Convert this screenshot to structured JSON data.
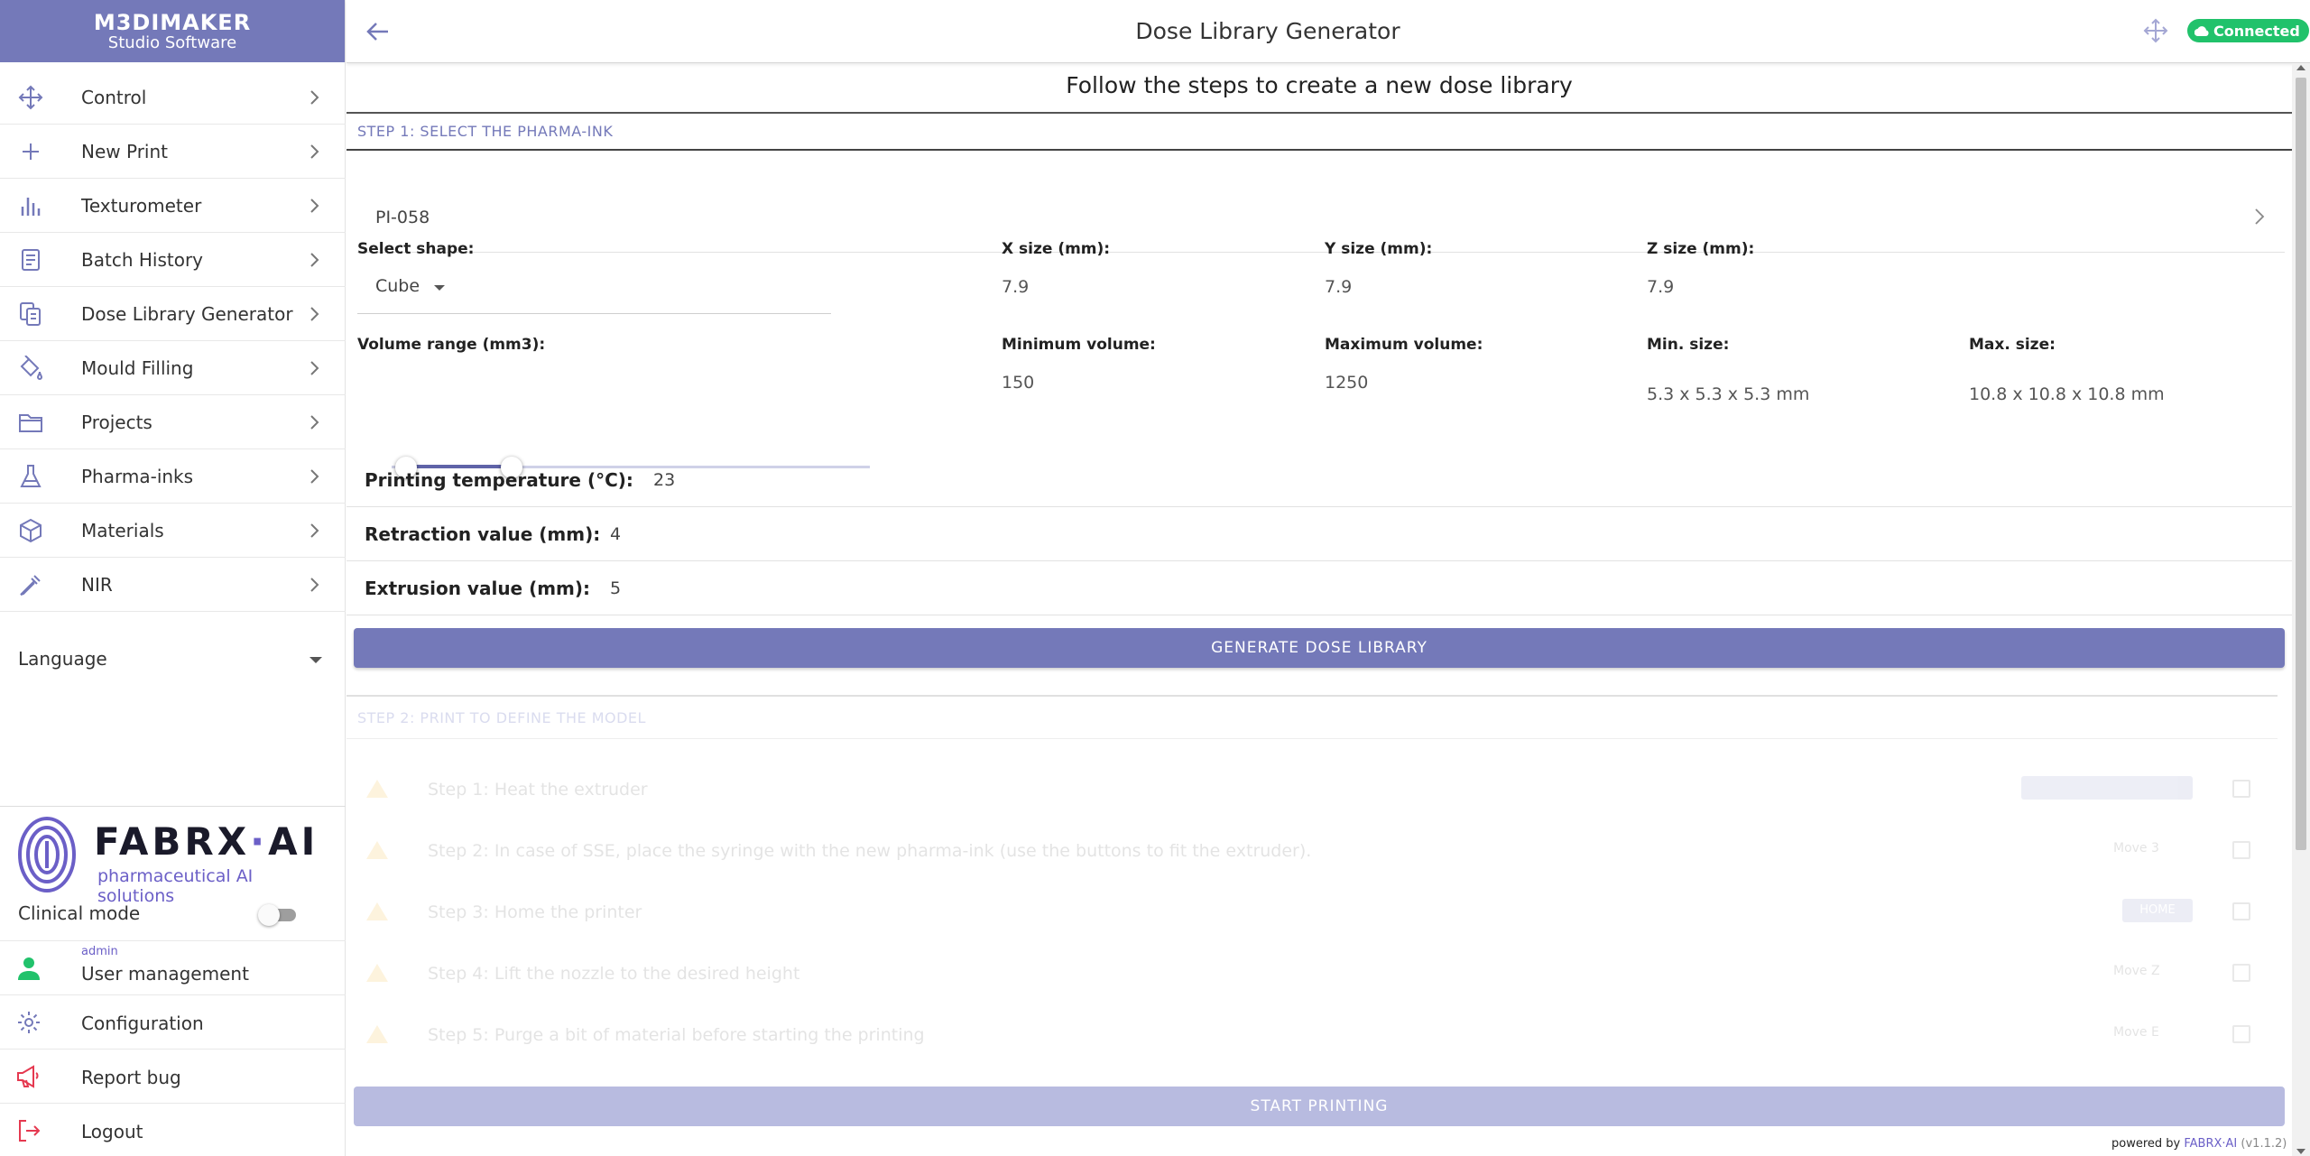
{
  "app": {
    "name_line1": "M3DIMAKER",
    "name_line2": "Studio Software"
  },
  "nav": [
    {
      "label": "Control",
      "icon": "move-arrows-icon"
    },
    {
      "label": "New Print",
      "icon": "plus-icon"
    },
    {
      "label": "Texturometer",
      "icon": "bar-chart-icon"
    },
    {
      "label": "Batch History",
      "icon": "document-icon"
    },
    {
      "label": "Dose Library Generator",
      "icon": "copy-document-icon"
    },
    {
      "label": "Mould Filling",
      "icon": "paint-bucket-icon"
    },
    {
      "label": "Projects",
      "icon": "folder-icon"
    },
    {
      "label": "Pharma-inks",
      "icon": "flask-icon"
    },
    {
      "label": "Materials",
      "icon": "cube-icon"
    },
    {
      "label": "NIR",
      "icon": "pipette-icon"
    }
  ],
  "language": {
    "label": "Language"
  },
  "brand": {
    "word_a": "FABRX",
    "dot": "·",
    "word_b": "AI",
    "tagline": "pharmaceutical AI solutions"
  },
  "clinical_mode": {
    "label": "Clinical mode",
    "enabled": false
  },
  "bottom_nav": {
    "user_role": "admin",
    "user_management": "User management",
    "configuration": "Configuration",
    "report_bug": "Report bug",
    "logout": "Logout"
  },
  "topbar": {
    "title": "Dose Library Generator",
    "status": "Connected",
    "status_color": "#21c26b"
  },
  "main": {
    "subtitle": "Follow the steps to create a new dose library",
    "step1_title": "STEP 1: SELECT THE PHARMA-INK",
    "pharma_ink": "PI-058",
    "select_shape_label": "Select shape:",
    "shape": "Cube",
    "x_size_label": "X size (mm):",
    "x_size": "7.9",
    "y_size_label": "Y size (mm):",
    "y_size": "7.9",
    "z_size_label": "Z size (mm):",
    "z_size": "7.9",
    "volume_range_label": "Volume range (mm3):",
    "volume_range": {
      "min": 0,
      "max": 5000,
      "low": 150,
      "high": 1250
    },
    "min_volume_label": "Minimum volume:",
    "min_volume": "150",
    "max_volume_label": "Maximum volume:",
    "max_volume": "1250",
    "min_size_label": "Min. size:",
    "min_size": "5.3 x 5.3 x 5.3 mm",
    "max_size_label": "Max. size:",
    "max_size": "10.8 x 10.8 x 10.8 mm",
    "printing_temp_label": "Printing temperature (°C):",
    "printing_temp": "23",
    "retraction_label": "Retraction value (mm):",
    "retraction": "4",
    "extrusion_label": "Extrusion value (mm):",
    "extrusion": "5",
    "generate_button": "GENERATE DOSE LIBRARY",
    "step2_title": "STEP 2: PRINT TO DEFINE THE MODEL",
    "substeps": [
      {
        "text": "Step 1: Heat the extruder",
        "button": ""
      },
      {
        "text": "Step 2: In case of SSE, place the syringe with the new pharma-ink (use the buttons to fit the extruder).",
        "button": "Move 3"
      },
      {
        "text": "Step 3: Home the printer",
        "button": "HOME"
      },
      {
        "text": "Step 4: Lift the nozzle to the desired height",
        "button": "Move Z"
      },
      {
        "text": "Step 5: Purge a bit of material before starting the printing",
        "button": "Move E"
      }
    ],
    "start_button": "START PRINTING"
  },
  "footer": {
    "powered_by": "powered by",
    "brand": "FABRX·AI",
    "version": "(v1.1.2)"
  },
  "colors": {
    "accent": "#7479b9",
    "accent_light": "#b8bbe0",
    "warning": "#f0a500",
    "danger": "#e53950",
    "success": "#21c26b"
  }
}
